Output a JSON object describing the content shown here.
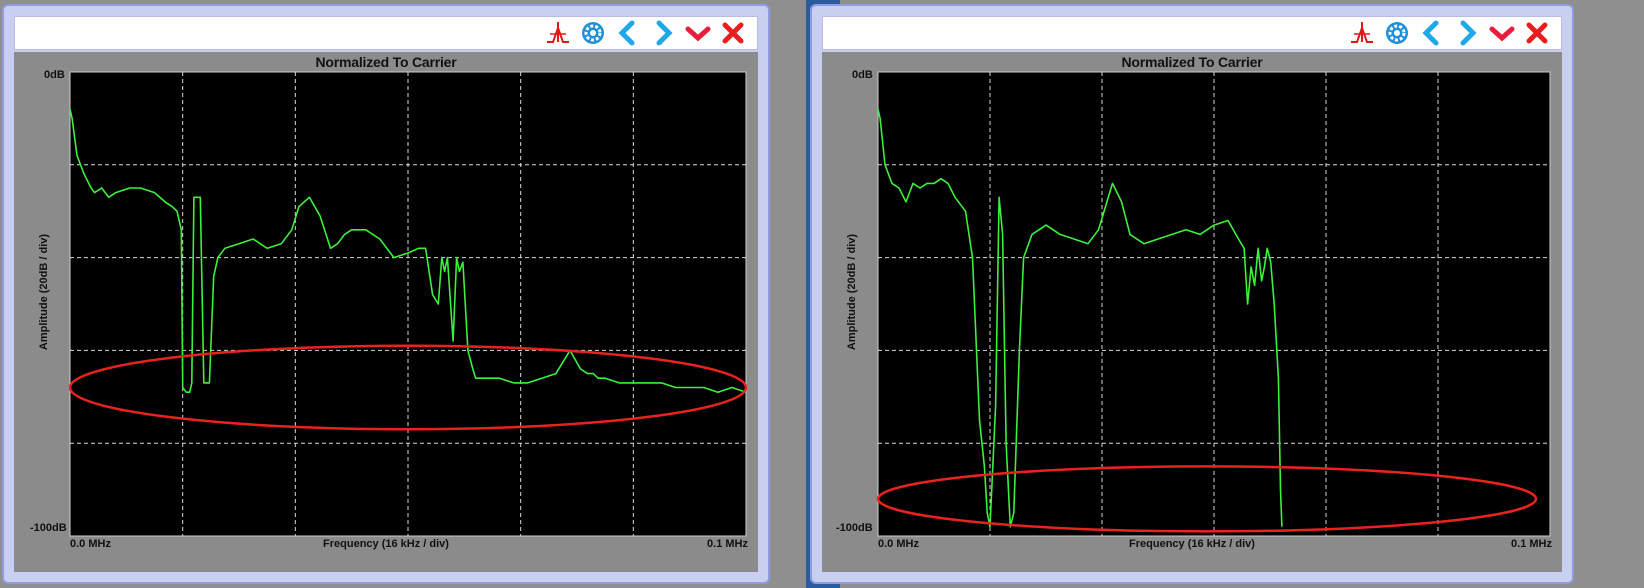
{
  "panels": [
    {
      "title": "Normalized To Carrier",
      "y_axis_label": "Amplitude (20dB / div)",
      "x_axis_label": "Frequency (16 kHz / div)",
      "y_top_label": "0dB",
      "y_bottom_label": "-100dB",
      "x_start_label": "0.0 MHz",
      "x_end_label": "0.1 MHz",
      "toolbar": {
        "icons": [
          "peak-icon",
          "gear-icon",
          "chevron-left-icon",
          "chevron-right-icon",
          "chevron-down-icon",
          "close-icon"
        ]
      }
    },
    {
      "title": "Normalized To Carrier",
      "y_axis_label": "Amplitude (20dB / div)",
      "x_axis_label": "Frequency (16 kHz / div)",
      "y_top_label": "0dB",
      "y_bottom_label": "-100dB",
      "x_start_label": "0.0 MHz",
      "x_end_label": "0.1 MHz",
      "toolbar": {
        "icons": [
          "peak-icon",
          "gear-icon",
          "chevron-left-icon",
          "chevron-right-icon",
          "chevron-down-icon",
          "close-icon"
        ]
      }
    }
  ],
  "colors": {
    "trace": "#3cf03c",
    "plot_background": "#000000",
    "grid": "#d8d8d8",
    "highlight_ellipse": "#e8231f",
    "panel_frame": "#8b8b8b",
    "window_frame": "#c8cff0"
  },
  "chart_data": [
    {
      "type": "line",
      "title": "Normalized To Carrier",
      "xlabel": "Frequency (16 kHz / div)",
      "ylabel": "Amplitude (20dB / div)",
      "xlim": [
        0,
        96
      ],
      "ylim": [
        -100,
        0
      ],
      "grid": true,
      "x_unit": "kHz",
      "y_unit": "dB",
      "annotation": {
        "type": "ellipse",
        "center": [
          48,
          -68
        ],
        "radius": [
          48,
          9
        ]
      },
      "series": [
        {
          "x": [
            0,
            0.3,
            1,
            2,
            3,
            3.5,
            4.5,
            5.5,
            6.5,
            7.5,
            8.5,
            10,
            12,
            13.5,
            14.5,
            15.2,
            15.8,
            16,
            16.5,
            17,
            17.3,
            17.6,
            18,
            18.5,
            19,
            19.8,
            20.4,
            21,
            22,
            24,
            26,
            28,
            30,
            31.5,
            32.5,
            34,
            35.5,
            37,
            38,
            39,
            40,
            42,
            44,
            46,
            48,
            49.5,
            50.5,
            51.5,
            52.3,
            52.8,
            53.2,
            53.6,
            54.4,
            54.9,
            55.3,
            55.8,
            56.5,
            57.2,
            57.6,
            59,
            61,
            63,
            65,
            67,
            69,
            71,
            72.5,
            73.5,
            74.3,
            75,
            76,
            78,
            80,
            82,
            84,
            86,
            88,
            90,
            92,
            94,
            96
          ],
          "y": [
            -8,
            -10,
            -18,
            -22,
            -25,
            -26,
            -25,
            -27,
            -26,
            -25.5,
            -25,
            -25,
            -26,
            -28,
            -29,
            -30,
            -34,
            -68,
            -69,
            -69,
            -67,
            -27,
            -27,
            -27,
            -67,
            -67,
            -44,
            -40,
            -38,
            -37,
            -36,
            -38,
            -37,
            -34,
            -29,
            -27,
            -31,
            -38,
            -37,
            -35,
            -34,
            -34,
            -36,
            -40,
            -39,
            -38,
            -38,
            -48,
            -50,
            -40,
            -43,
            -40,
            -58,
            -40,
            -43,
            -41,
            -60,
            -64,
            -66,
            -66,
            -66,
            -67,
            -67,
            -66,
            -65,
            -60,
            -64,
            -65,
            -65,
            -66,
            -66,
            -67,
            -67,
            -67,
            -67,
            -68,
            -68,
            -68,
            -69,
            -68,
            -69
          ]
        }
      ]
    },
    {
      "type": "line",
      "title": "Normalized To Carrier",
      "xlabel": "Frequency (16 kHz / div)",
      "ylabel": "Amplitude (20dB / div)",
      "xlim": [
        0,
        96
      ],
      "ylim": [
        -100,
        0
      ],
      "grid": true,
      "x_unit": "kHz",
      "y_unit": "dB",
      "annotation": {
        "type": "ellipse",
        "center": [
          47,
          -92
        ],
        "radius": [
          47,
          7
        ]
      },
      "series": [
        {
          "x": [
            0,
            0.3,
            1,
            2,
            3,
            4,
            5,
            6,
            7,
            8,
            9,
            10,
            11,
            12.5,
            13.5,
            14.5,
            15.2,
            15.6,
            16,
            16.4,
            16.8,
            17.3,
            17.8,
            18.3,
            18.9,
            19.4,
            20.2,
            20.8,
            22,
            24,
            26,
            28,
            30,
            31.5,
            32.5,
            33.5,
            34.8,
            36,
            38,
            40,
            42,
            44,
            46,
            48,
            50,
            51.5,
            52.3,
            52.8,
            53.3,
            53.8,
            54.3,
            54.8,
            55.2,
            55.6,
            56.1,
            56.6,
            57.2,
            57.5,
            57.7
          ],
          "y": [
            -8,
            -10,
            -20,
            -24,
            -25,
            -28,
            -24,
            -25,
            -24,
            -24,
            -23,
            -24,
            -27,
            -30,
            -40,
            -75,
            -85,
            -95,
            -98,
            -85,
            -72,
            -27,
            -35,
            -80,
            -98,
            -95,
            -60,
            -40,
            -35,
            -33,
            -35,
            -36,
            -37,
            -34,
            -29,
            -24,
            -28,
            -35,
            -37,
            -36,
            -35,
            -34,
            -35,
            -33,
            -32,
            -36,
            -38,
            -50,
            -42,
            -46,
            -38,
            -45,
            -42,
            -38,
            -41,
            -50,
            -66,
            -90,
            -98
          ]
        }
      ]
    }
  ]
}
